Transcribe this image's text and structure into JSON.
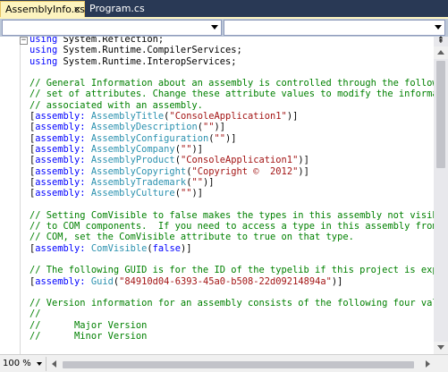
{
  "tabs": [
    {
      "label": "AssemblyInfo.cs",
      "close": "×"
    },
    {
      "label": "Program.cs"
    }
  ],
  "navbar": {
    "left_value": "",
    "right_value": ""
  },
  "editor": {
    "collapse_glyph": "−",
    "lines": [
      [
        {
          "t": "using",
          "c": "kw"
        },
        {
          "t": " System.Reflection;",
          "c": ""
        }
      ],
      [
        {
          "t": "using",
          "c": "kw"
        },
        {
          "t": " System.Runtime.CompilerServices;",
          "c": ""
        }
      ],
      [
        {
          "t": "using",
          "c": "kw"
        },
        {
          "t": " System.Runtime.InteropServices;",
          "c": ""
        }
      ],
      [],
      [
        {
          "t": "// General Information about an assembly is controlled through the following",
          "c": "cm"
        }
      ],
      [
        {
          "t": "// set of attributes. Change these attribute values to modify the information",
          "c": "cm"
        }
      ],
      [
        {
          "t": "// associated with an assembly.",
          "c": "cm"
        }
      ],
      [
        {
          "t": "[",
          "c": ""
        },
        {
          "t": "assembly:",
          "c": "kw"
        },
        {
          "t": " ",
          "c": ""
        },
        {
          "t": "AssemblyTitle",
          "c": "ty"
        },
        {
          "t": "(",
          "c": ""
        },
        {
          "t": "\"ConsoleApplication1\"",
          "c": "st"
        },
        {
          "t": ")]",
          "c": ""
        }
      ],
      [
        {
          "t": "[",
          "c": ""
        },
        {
          "t": "assembly:",
          "c": "kw"
        },
        {
          "t": " ",
          "c": ""
        },
        {
          "t": "AssemblyDescription",
          "c": "ty"
        },
        {
          "t": "(",
          "c": ""
        },
        {
          "t": "\"\"",
          "c": "st"
        },
        {
          "t": ")]",
          "c": ""
        }
      ],
      [
        {
          "t": "[",
          "c": ""
        },
        {
          "t": "assembly:",
          "c": "kw"
        },
        {
          "t": " ",
          "c": ""
        },
        {
          "t": "AssemblyConfiguration",
          "c": "ty"
        },
        {
          "t": "(",
          "c": ""
        },
        {
          "t": "\"\"",
          "c": "st"
        },
        {
          "t": ")]",
          "c": ""
        }
      ],
      [
        {
          "t": "[",
          "c": ""
        },
        {
          "t": "assembly:",
          "c": "kw"
        },
        {
          "t": " ",
          "c": ""
        },
        {
          "t": "AssemblyCompany",
          "c": "ty"
        },
        {
          "t": "(",
          "c": ""
        },
        {
          "t": "\"\"",
          "c": "st"
        },
        {
          "t": ")]",
          "c": ""
        }
      ],
      [
        {
          "t": "[",
          "c": ""
        },
        {
          "t": "assembly:",
          "c": "kw"
        },
        {
          "t": " ",
          "c": ""
        },
        {
          "t": "AssemblyProduct",
          "c": "ty"
        },
        {
          "t": "(",
          "c": ""
        },
        {
          "t": "\"ConsoleApplication1\"",
          "c": "st"
        },
        {
          "t": ")]",
          "c": ""
        }
      ],
      [
        {
          "t": "[",
          "c": ""
        },
        {
          "t": "assembly:",
          "c": "kw"
        },
        {
          "t": " ",
          "c": ""
        },
        {
          "t": "AssemblyCopyright",
          "c": "ty"
        },
        {
          "t": "(",
          "c": ""
        },
        {
          "t": "\"Copyright ©  2012\"",
          "c": "st"
        },
        {
          "t": ")]",
          "c": ""
        }
      ],
      [
        {
          "t": "[",
          "c": ""
        },
        {
          "t": "assembly:",
          "c": "kw"
        },
        {
          "t": " ",
          "c": ""
        },
        {
          "t": "AssemblyTrademark",
          "c": "ty"
        },
        {
          "t": "(",
          "c": ""
        },
        {
          "t": "\"\"",
          "c": "st"
        },
        {
          "t": ")]",
          "c": ""
        }
      ],
      [
        {
          "t": "[",
          "c": ""
        },
        {
          "t": "assembly:",
          "c": "kw"
        },
        {
          "t": " ",
          "c": ""
        },
        {
          "t": "AssemblyCulture",
          "c": "ty"
        },
        {
          "t": "(",
          "c": ""
        },
        {
          "t": "\"\"",
          "c": "st"
        },
        {
          "t": ")]",
          "c": ""
        }
      ],
      [],
      [
        {
          "t": "// Setting ComVisible to false makes the types in this assembly not visible",
          "c": "cm"
        }
      ],
      [
        {
          "t": "// to COM components.  If you need to access a type in this assembly from",
          "c": "cm"
        }
      ],
      [
        {
          "t": "// COM, set the ComVisible attribute to true on that type.",
          "c": "cm"
        }
      ],
      [
        {
          "t": "[",
          "c": ""
        },
        {
          "t": "assembly:",
          "c": "kw"
        },
        {
          "t": " ",
          "c": ""
        },
        {
          "t": "ComVisible",
          "c": "ty"
        },
        {
          "t": "(",
          "c": ""
        },
        {
          "t": "false",
          "c": "kw"
        },
        {
          "t": ")]",
          "c": ""
        }
      ],
      [],
      [
        {
          "t": "// The following GUID is for the ID of the typelib if this project is exposed to",
          "c": "cm"
        }
      ],
      [
        {
          "t": "[",
          "c": ""
        },
        {
          "t": "assembly:",
          "c": "kw"
        },
        {
          "t": " ",
          "c": ""
        },
        {
          "t": "Guid",
          "c": "ty"
        },
        {
          "t": "(",
          "c": ""
        },
        {
          "t": "\"84910d04-6393-45a0-b508-22d09214894a\"",
          "c": "st"
        },
        {
          "t": ")]",
          "c": ""
        }
      ],
      [],
      [
        {
          "t": "// Version information for an assembly consists of the following four values:",
          "c": "cm"
        }
      ],
      [
        {
          "t": "//",
          "c": "cm"
        }
      ],
      [
        {
          "t": "//      Major Version",
          "c": "cm"
        }
      ],
      [
        {
          "t": "//      Minor Version",
          "c": "cm"
        }
      ]
    ]
  },
  "scrollbar": {
    "splitter_glyph": "⇞"
  },
  "bottombar": {
    "zoom": "100 %"
  },
  "colors": {
    "keyword": "#0000ff",
    "comment": "#008000",
    "type": "#2b91af",
    "string": "#a31515",
    "active_tab": "#fdf4bf",
    "frame": "#293955"
  }
}
